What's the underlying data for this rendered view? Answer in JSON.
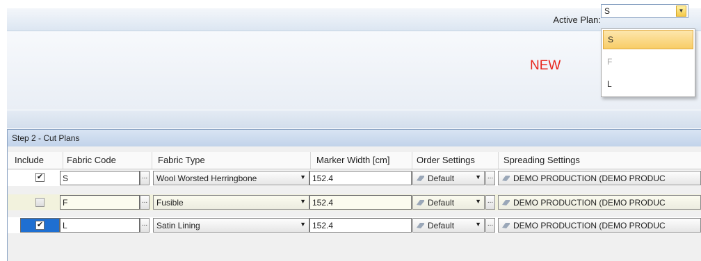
{
  "toolbar": {
    "active_plan_label": "Active Plan:",
    "active_plan_value": "S"
  },
  "dropdown": {
    "options": [
      {
        "label": "S",
        "state": "highlighted"
      },
      {
        "label": "F",
        "state": "disabled"
      },
      {
        "label": "L",
        "state": "normal"
      }
    ]
  },
  "banner": {
    "new_label": "NEW",
    "new_color": "#e8261d"
  },
  "step": {
    "title": "Step 2 - Cut Plans"
  },
  "columns": [
    "Include",
    "Fabric Code",
    "Fabric Type",
    "Marker Width [cm]",
    "Order Settings",
    "Spreading Settings"
  ],
  "rows": [
    {
      "include": true,
      "selected": false,
      "fabric_code": "S",
      "fabric_type": "Wool Worsted Herringbone",
      "marker_width": "152.4",
      "order": "Default",
      "spreading": "DEMO PRODUCTION (DEMO PRODUC"
    },
    {
      "include": false,
      "selected": false,
      "fabric_code": "F",
      "fabric_type": "Fusible",
      "marker_width": "152.4",
      "order": "Default",
      "spreading": "DEMO PRODUCTION (DEMO PRODUC"
    },
    {
      "include": true,
      "selected": true,
      "fabric_code": "L",
      "fabric_type": "Satin Lining",
      "marker_width": "152.4",
      "order": "Default",
      "spreading": "DEMO PRODUCTION (DEMO PRODUC"
    }
  ],
  "glyphs": {
    "checkmark": "✔",
    "ellipsis": "...",
    "dropdown_arrow": "▼"
  }
}
